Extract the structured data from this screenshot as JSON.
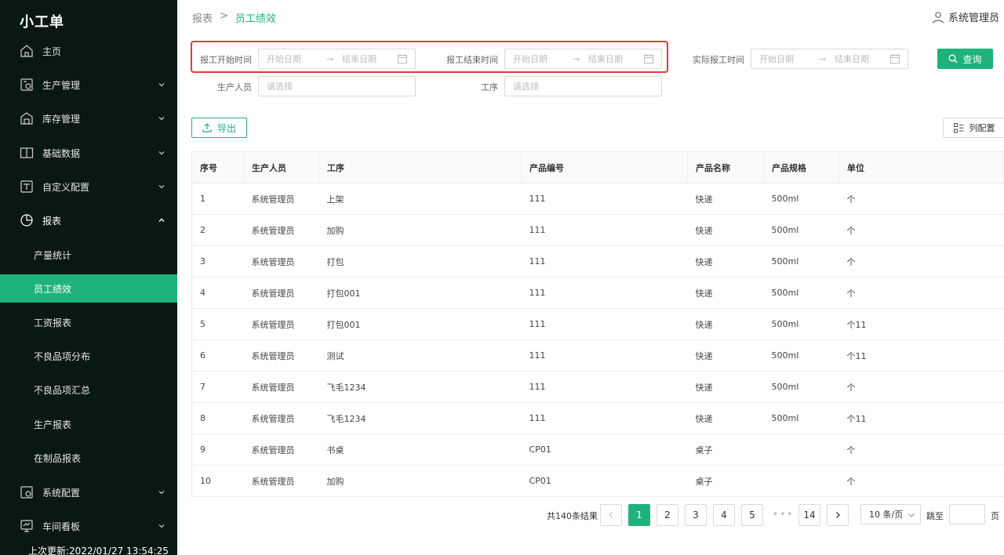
{
  "app": {
    "name": "小工单",
    "last_update": "上次更新:2022/01/27 13:54:25"
  },
  "sidebar": {
    "items": [
      {
        "label": "主页",
        "icon": "home-icon",
        "has_arrow": false
      },
      {
        "label": "生产管理",
        "icon": "production-icon",
        "has_arrow": true
      },
      {
        "label": "库存管理",
        "icon": "warehouse-icon",
        "has_arrow": true
      },
      {
        "label": "基础数据",
        "icon": "book-icon",
        "has_arrow": true
      },
      {
        "label": "自定义配置",
        "icon": "custom-config-icon",
        "has_arrow": true
      },
      {
        "label": "报表",
        "icon": "pie-chart-icon",
        "has_arrow": true,
        "expanded": true
      },
      {
        "label": "系统配置",
        "icon": "system-config-icon",
        "has_arrow": true
      },
      {
        "label": "车间看板",
        "icon": "monitor-icon",
        "has_arrow": true
      }
    ],
    "report_sub_items": [
      {
        "label": "产量统计",
        "active": false
      },
      {
        "label": "员工绩效",
        "active": true
      },
      {
        "label": "工资报表",
        "active": false
      },
      {
        "label": "不良品项分布",
        "active": false
      },
      {
        "label": "不良品项汇总",
        "active": false
      },
      {
        "label": "生产报表",
        "active": false
      },
      {
        "label": "在制品报表",
        "active": false
      }
    ]
  },
  "header": {
    "breadcrumb": [
      "报表",
      ">",
      "员工绩效"
    ],
    "user": "系统管理员"
  },
  "filters": {
    "start_time_label": "报工开始时间",
    "end_time_label": "报工结束时间",
    "actual_time_label": "实际报工时间",
    "start_placeholder": "开始日期",
    "end_placeholder": "结束日期",
    "range_arrow": "→",
    "worker_label": "生产人员",
    "process_label": "工序",
    "select_placeholder": "请选择",
    "query_button": "查询"
  },
  "toolbar": {
    "export_button": "导出",
    "column_config_button": "列配置"
  },
  "table": {
    "headers": [
      "序号",
      "生产人员",
      "工序",
      "产品编号",
      "产品名称",
      "产品规格",
      "单位"
    ],
    "rows": [
      [
        "1",
        "系统管理员",
        "上架",
        "111",
        "快递",
        "500ml",
        "个"
      ],
      [
        "2",
        "系统管理员",
        "加购",
        "111",
        "快递",
        "500ml",
        "个"
      ],
      [
        "3",
        "系统管理员",
        "打包",
        "111",
        "快递",
        "500ml",
        "个"
      ],
      [
        "4",
        "系统管理员",
        "打包001",
        "111",
        "快递",
        "500ml",
        "个"
      ],
      [
        "5",
        "系统管理员",
        "打包001",
        "111",
        "快递",
        "500ml",
        "个11"
      ],
      [
        "6",
        "系统管理员",
        "测试",
        "111",
        "快递",
        "500ml",
        "个11"
      ],
      [
        "7",
        "系统管理员",
        "飞毛1234",
        "111",
        "快递",
        "500ml",
        "个"
      ],
      [
        "8",
        "系统管理员",
        "飞毛1234",
        "111",
        "快递",
        "500ml",
        "个11"
      ],
      [
        "9",
        "系统管理员",
        "书桌",
        "CP01",
        "桌子",
        "",
        "个"
      ],
      [
        "10",
        "系统管理员",
        "加购",
        "CP01",
        "桌子",
        "",
        "个"
      ]
    ]
  },
  "pagination": {
    "total_text": "共140条结果",
    "pages": [
      "1",
      "2",
      "3",
      "4",
      "5"
    ],
    "current_page": "1",
    "ellipsis": "•••",
    "last_page": "14",
    "page_size": "10 条/页",
    "jump_label": "跳至",
    "jump_unit": "页"
  },
  "colors": {
    "accent": "#20b27b",
    "sidebar_bg": "#0a1812",
    "highlight": "#e03a3a"
  }
}
